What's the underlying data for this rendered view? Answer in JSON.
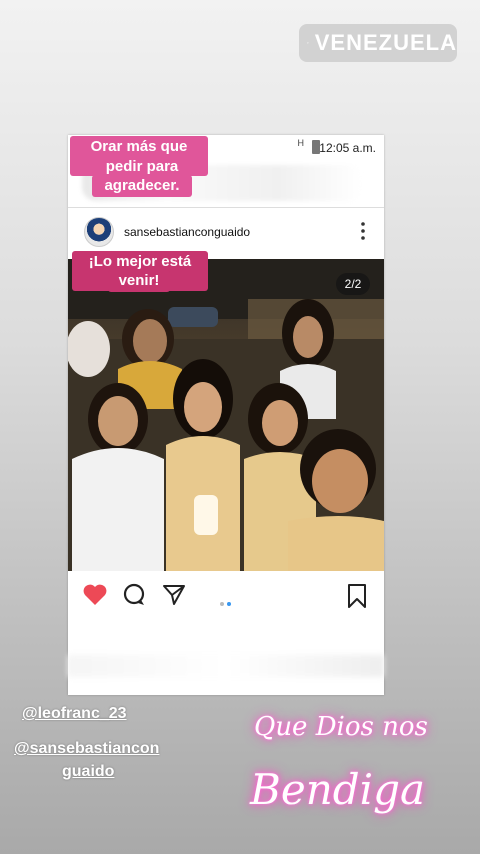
{
  "location_sticker": {
    "label": "VENEZUELA",
    "icon": "location-pin-icon"
  },
  "phone_status": {
    "time": "12:05 a.m.",
    "signal": "H"
  },
  "caption_top": {
    "line1": "Orar más que para",
    "line2": "pedir para",
    "line3": "agradecer."
  },
  "post": {
    "username": "sansebastianconguaido",
    "image_counter": "2/2",
    "overlay_caption": {
      "line1": "¡Lo mejor está por",
      "line2": "venir!"
    }
  },
  "actions": {
    "like_icon": "heart-icon",
    "comment_icon": "comment-icon",
    "share_icon": "send-icon",
    "save_icon": "bookmark-icon",
    "like_color": "#ed4956",
    "dot_active_color": "#3897f0"
  },
  "mentions": {
    "first": "@leofranc_23",
    "second_line1": "@sansebastiancon",
    "second_line2": "guaido"
  },
  "script_text": {
    "line1": "Que Dios nos",
    "line2": "Bendiga"
  },
  "colors": {
    "pill": "#e0569a",
    "neon_glow": "#ff5fd1"
  }
}
